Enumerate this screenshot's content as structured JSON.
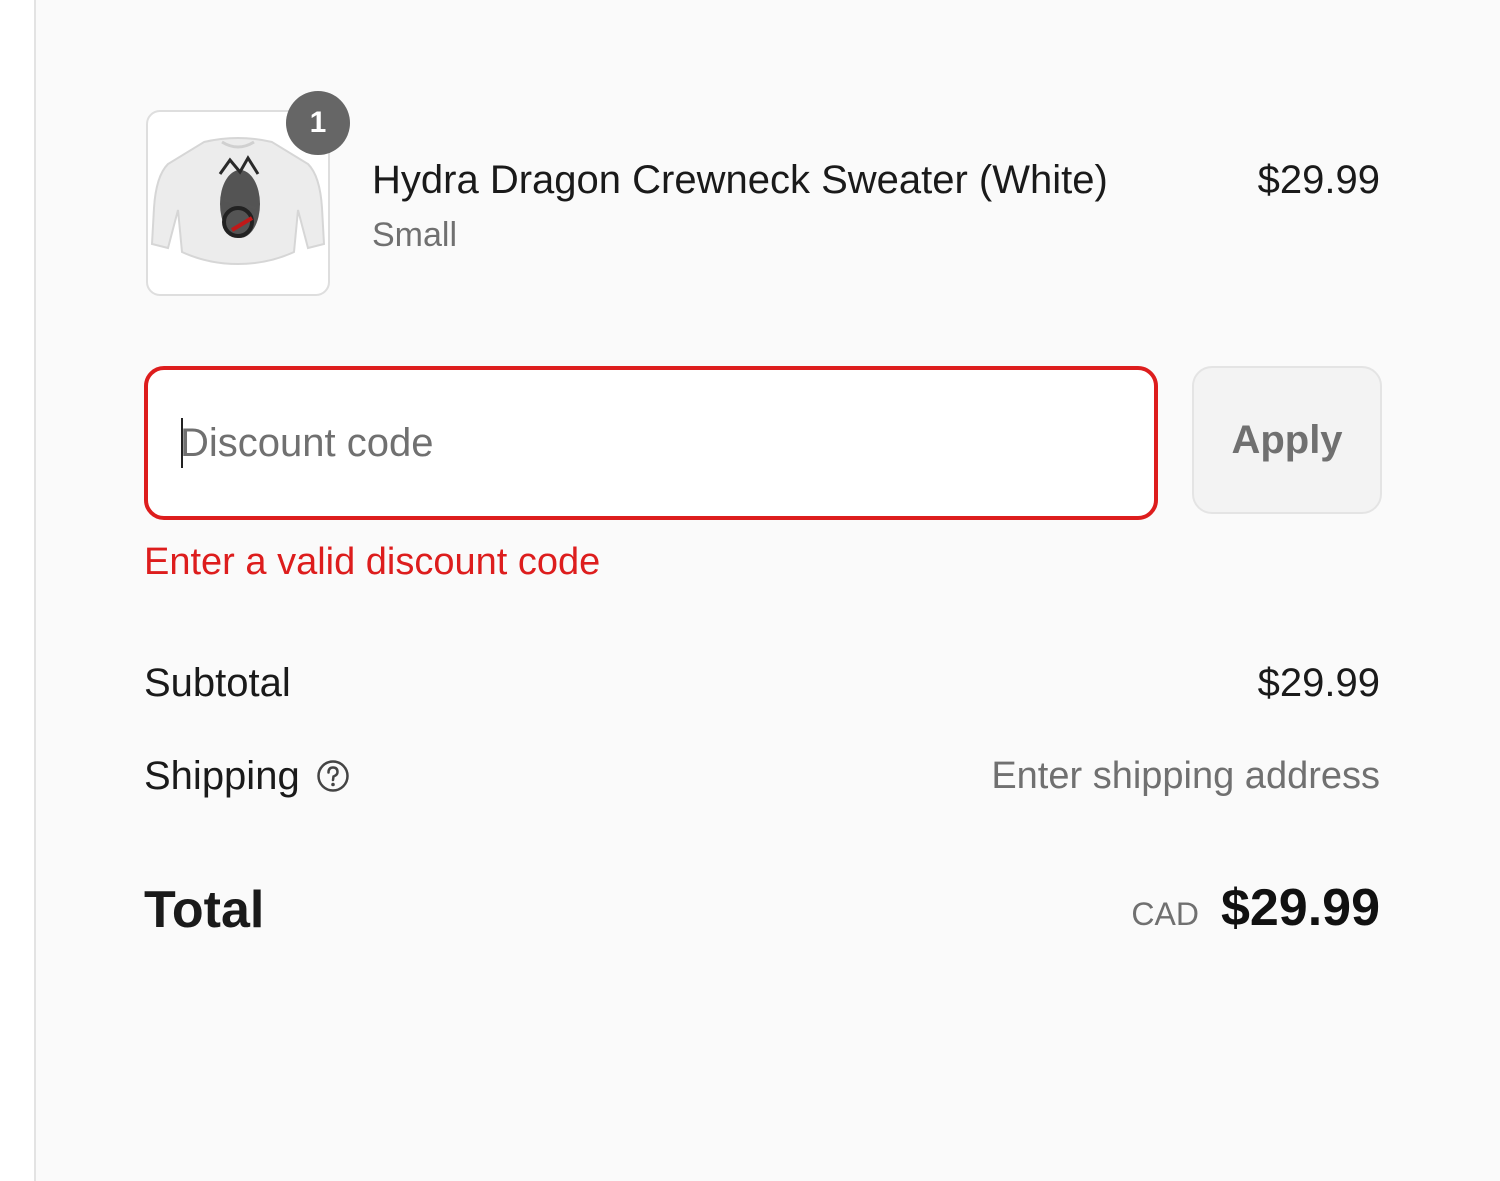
{
  "line_item": {
    "quantity": "1",
    "name": "Hydra Dragon Crewneck Sweater (White)",
    "variant": "Small",
    "price": "$29.99",
    "image_icon": "sweater-product-image"
  },
  "discount": {
    "placeholder": "Discount code",
    "value": "",
    "apply_label": "Apply",
    "error": "Enter a valid discount code"
  },
  "summary": {
    "subtotal_label": "Subtotal",
    "subtotal_value": "$29.99",
    "shipping_label": "Shipping",
    "shipping_value": "Enter shipping address",
    "total_label": "Total",
    "currency": "CAD",
    "total_value": "$29.99"
  },
  "colors": {
    "error": "#dd1d1d",
    "badge": "#666666",
    "muted": "#707070",
    "panel_bg": "#fafafa"
  }
}
